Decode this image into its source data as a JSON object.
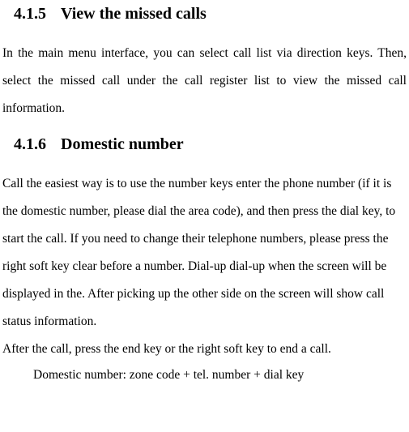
{
  "section_415": {
    "number": "4.1.5",
    "title": "View the missed calls",
    "body": "In the main menu interface, you can select call list via direction keys. Then, select the missed call under the call register list to view the missed call information."
  },
  "section_416": {
    "number": "4.1.6",
    "title": "Domestic number",
    "body1": "Call the easiest way is to use the number keys enter the phone number (if it is the domestic number, please dial the area code), and then press the dial key, to start the call. If you need to change their telephone numbers, please press the right soft key clear before a number. Dial-up dial-up when the screen will be displayed in the. After picking up the other side on the screen will show call status information.",
    "body2": "After the call, press the end key or the right soft key to end a call.",
    "note": "Domestic number: zone code + tel. number + dial key"
  }
}
